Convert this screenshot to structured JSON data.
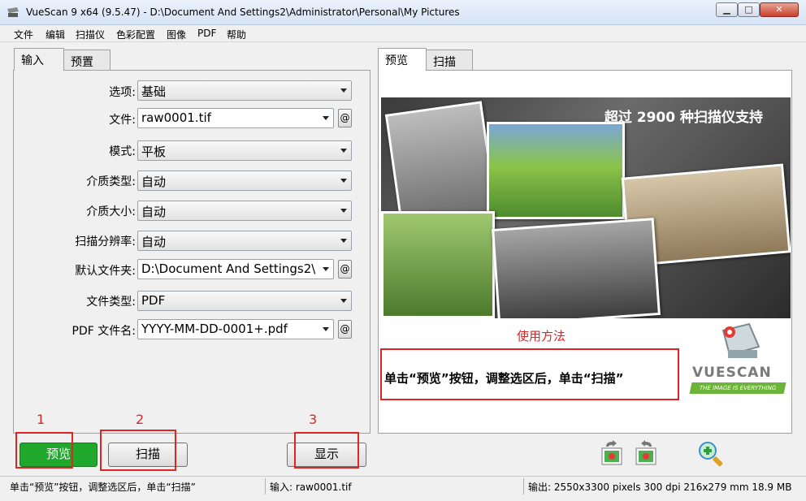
{
  "window": {
    "title": "VueScan 9 x64 (9.5.47) - D:\\Document And Settings2\\Administrator\\Personal\\My Pictures"
  },
  "menu": [
    "文件",
    "编辑",
    "扫描仪",
    "色彩配置",
    "图像",
    "PDF",
    "帮助"
  ],
  "left_tabs": [
    "输入",
    "预置"
  ],
  "right_tabs": [
    "预览",
    "扫描"
  ],
  "form": {
    "rows": [
      {
        "label": "选项:",
        "value": "基础"
      },
      {
        "label": "文件:",
        "value": "raw0001.tif"
      },
      {
        "label": "模式:",
        "value": "平板"
      },
      {
        "label": "介质类型:",
        "value": "自动"
      },
      {
        "label": "介质大小:",
        "value": "自动"
      },
      {
        "label": "扫描分辨率:",
        "value": "自动"
      },
      {
        "label": "默认文件夹:",
        "value": "D:\\Document And Settings2\\"
      },
      {
        "label": "文件类型:",
        "value": "PDF"
      },
      {
        "label": "PDF 文件名:",
        "value": "YYYY-MM-DD-0001+.pdf"
      }
    ],
    "at_label": "@"
  },
  "buttons": {
    "preview": "预览",
    "scan": "扫描",
    "show": "显示"
  },
  "annotations": {
    "n1": "1",
    "n2": "2",
    "n3": "3"
  },
  "preview": {
    "collage_caption": "超过 2900 种扫描仪支持",
    "howto_title": "使用方法",
    "howto_text": "单击“预览”按钮，调整选区后，单击“扫描”",
    "logo_text": "VUESCAN",
    "logo_tag": "THE IMAGE IS EVERYTHING"
  },
  "status": {
    "left": "单击“预览”按钮，调整选区后，单击“扫描”",
    "mid": "输入: raw0001.tif",
    "right": "输出: 2550x3300 pixels 300 dpi 216x279 mm 18.9 MB"
  },
  "colors": {
    "accent_red": "#e02424",
    "preview_green": "#1fa82b"
  }
}
